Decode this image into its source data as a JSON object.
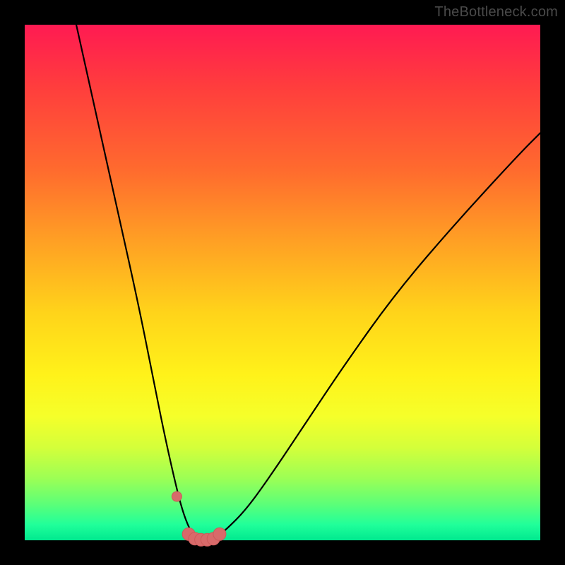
{
  "watermark": "TheBottleneck.com",
  "colors": {
    "page_bg": "#000000",
    "curve_stroke": "#000000",
    "marker_fill": "#d86a6a",
    "marker_stroke": "#cc5a5a",
    "watermark_color": "#4a4a4a",
    "gradient_stops": [
      "#ff1a52",
      "#ff3d3d",
      "#ff6a2e",
      "#ffa024",
      "#ffd41a",
      "#fff21a",
      "#f5ff2a",
      "#d4ff3a",
      "#9cff55",
      "#5cff78",
      "#20ff9a",
      "#00e98f"
    ]
  },
  "chart_data": {
    "type": "line",
    "title": "",
    "xlabel": "",
    "ylabel": "",
    "xlim": [
      0,
      100
    ],
    "ylim": [
      0,
      100
    ],
    "annotations": [],
    "series": [
      {
        "name": "bottleneck-curve",
        "x": [
          10,
          14,
          18,
          22,
          25,
          27,
          29,
          30.5,
          32,
          33.5,
          35,
          37,
          39,
          43,
          48,
          54,
          62,
          72,
          84,
          96,
          100
        ],
        "y": [
          100,
          82,
          64,
          46,
          31,
          21,
          12,
          6,
          2,
          0,
          0,
          0.5,
          2,
          6,
          13,
          22,
          34,
          48,
          62,
          75,
          79
        ]
      }
    ],
    "markers": {
      "name": "highlight-dots",
      "x": [
        29.5,
        31.8,
        33.0,
        34.2,
        35.4,
        36.6,
        37.8
      ],
      "y": [
        8.5,
        1.2,
        0.3,
        0.1,
        0.1,
        0.3,
        1.2
      ]
    }
  }
}
